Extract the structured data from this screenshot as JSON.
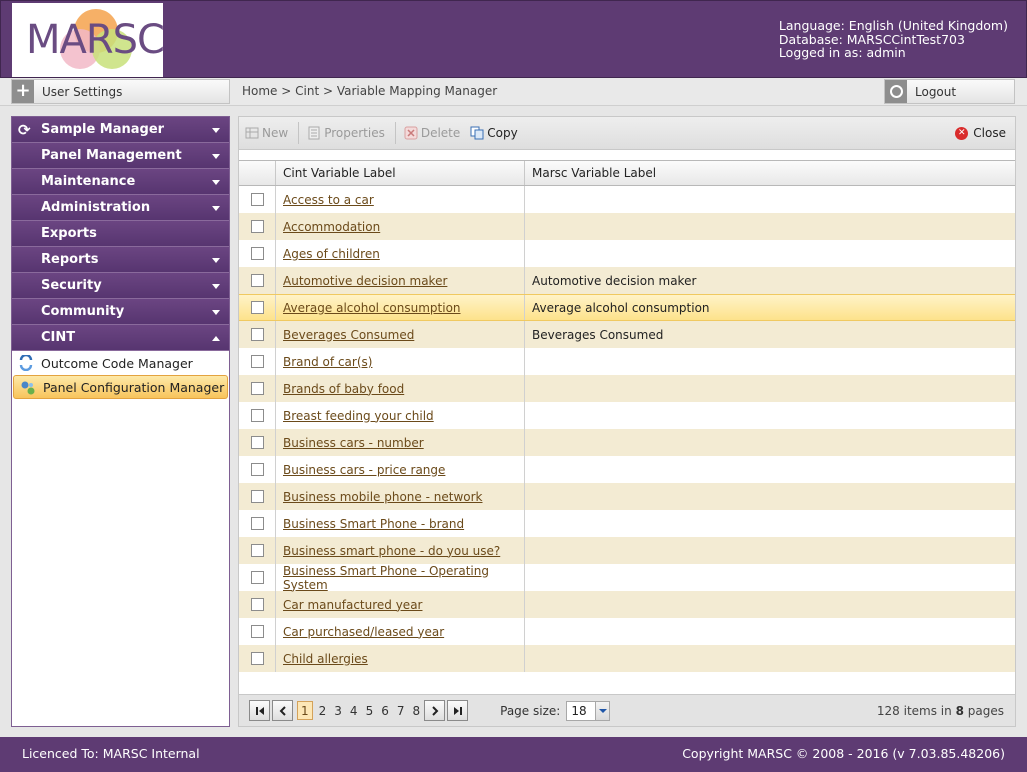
{
  "brand": {
    "logo_text": "MARSC"
  },
  "user_info": {
    "language": "Language: English (United Kingdom)",
    "database": "Database: MARSCCintTest703",
    "logged_in": "Logged in as: admin"
  },
  "top_toolbar": {
    "user_settings_label": "User Settings",
    "breadcrumb": "Home > Cint > Variable Mapping Manager",
    "logout_label": "Logout"
  },
  "sidebar": {
    "sections": [
      {
        "label": "Sample Manager",
        "expanded": false
      },
      {
        "label": "Panel Management",
        "expanded": false
      },
      {
        "label": "Maintenance",
        "expanded": false
      },
      {
        "label": "Administration",
        "expanded": false
      },
      {
        "label": "Exports"
      },
      {
        "label": "Reports",
        "expanded": false
      },
      {
        "label": "Security",
        "expanded": false
      },
      {
        "label": "Community",
        "expanded": false
      },
      {
        "label": "CINT",
        "expanded": true
      }
    ],
    "sub_items": [
      {
        "label": "Outcome Code Manager",
        "icon": "outcome-code-icon"
      },
      {
        "label": "Panel Configuration Manager",
        "icon": "panel-config-icon",
        "active": true
      }
    ]
  },
  "commands": {
    "new_label": "New",
    "properties_label": "Properties",
    "delete_label": "Delete",
    "copy_label": "Copy",
    "close_label": "Close"
  },
  "grid": {
    "columns": [
      "Cint Variable Label",
      "Marsc Variable Label"
    ],
    "rows": [
      {
        "cint": "Access to a car",
        "marsc": ""
      },
      {
        "cint": "Accommodation",
        "marsc": ""
      },
      {
        "cint": "Ages of children",
        "marsc": ""
      },
      {
        "cint": "Automotive decision maker",
        "marsc": "Automotive decision maker"
      },
      {
        "cint": "Average alcohol consumption",
        "marsc": "Average alcohol consumption"
      },
      {
        "cint": "Beverages Consumed",
        "marsc": "Beverages Consumed"
      },
      {
        "cint": "Brand of car(s)",
        "marsc": ""
      },
      {
        "cint": "Brands of baby food",
        "marsc": ""
      },
      {
        "cint": "Breast feeding your child",
        "marsc": ""
      },
      {
        "cint": "Business cars - number",
        "marsc": ""
      },
      {
        "cint": "Business cars - price range",
        "marsc": ""
      },
      {
        "cint": "Business mobile phone - network",
        "marsc": ""
      },
      {
        "cint": "Business Smart Phone - brand",
        "marsc": ""
      },
      {
        "cint": "Business smart phone - do you use?",
        "marsc": ""
      },
      {
        "cint": "Business Smart Phone - Operating System",
        "marsc": ""
      },
      {
        "cint": "Car manufactured year",
        "marsc": ""
      },
      {
        "cint": "Car purchased/leased year",
        "marsc": ""
      },
      {
        "cint": "Child allergies",
        "marsc": ""
      }
    ],
    "highlighted_row": 4
  },
  "pager": {
    "pages": [
      "1",
      "2",
      "3",
      "4",
      "5",
      "6",
      "7",
      "8"
    ],
    "current_page": "1",
    "page_size_label": "Page size:",
    "page_size": "18",
    "items_count": "128",
    "items_text": "items in",
    "pages_count": "8",
    "pages_text": "pages"
  },
  "footer": {
    "licence": "Licenced To: MARSC Internal",
    "copyright": "Copyright MARSC © 2008 - 2016  (v 7.03.85.48206)"
  },
  "colors": {
    "brand_purple": "#5e3b73",
    "link_brown": "#6b4a1a",
    "alt_row": "#f3ebd3",
    "highlight": "#fde28b"
  }
}
